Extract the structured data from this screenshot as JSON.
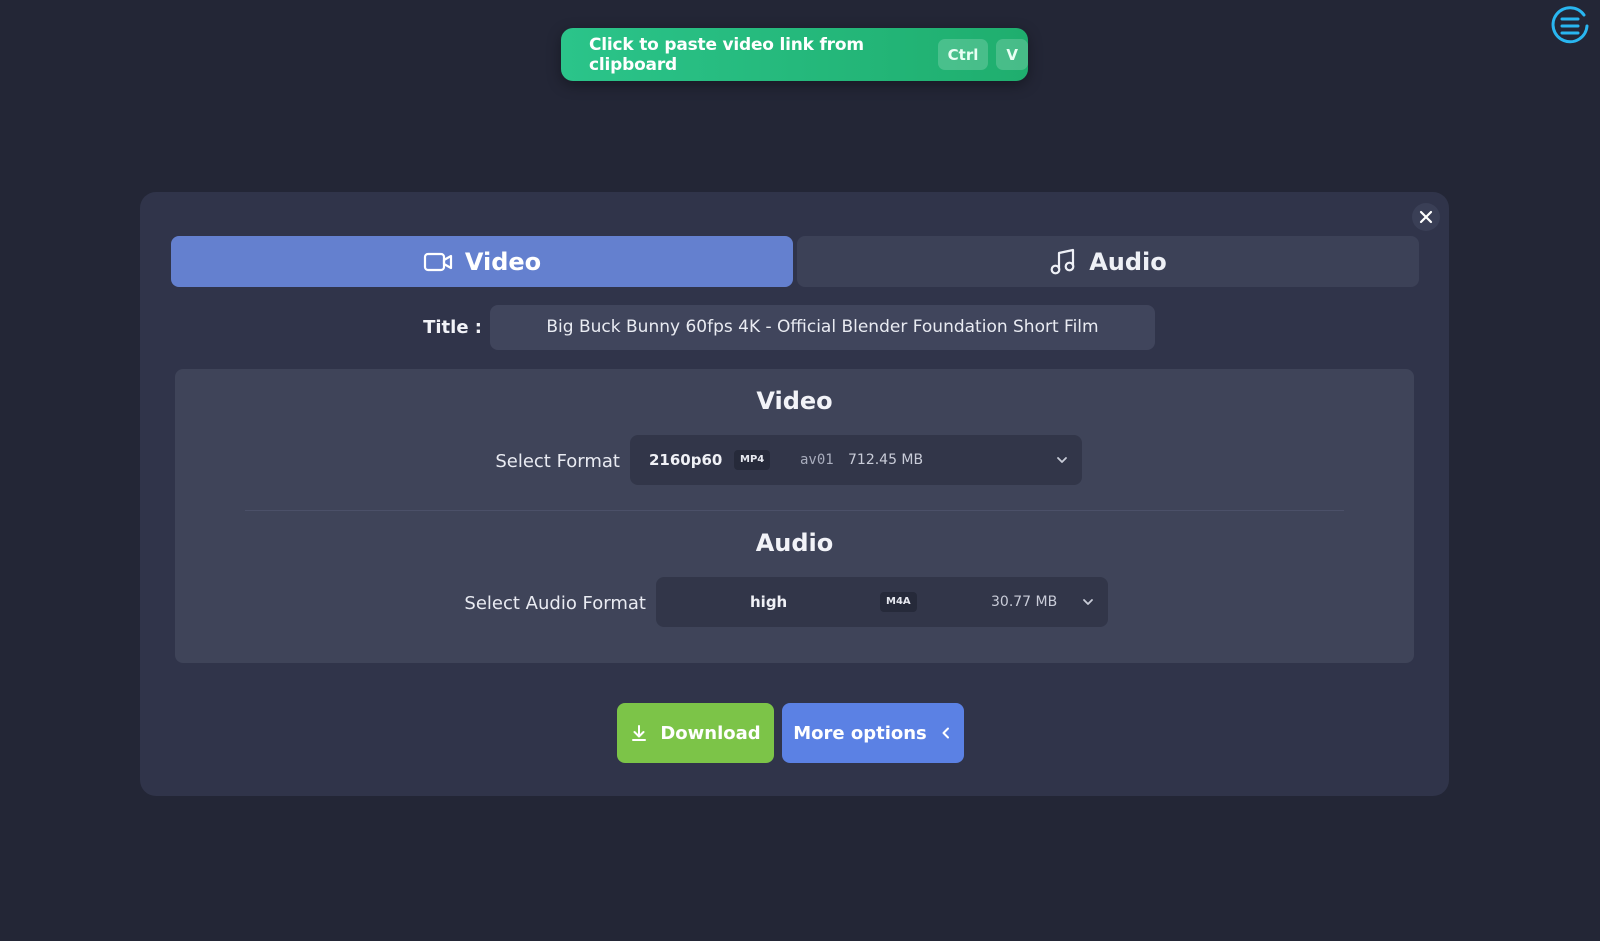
{
  "paste": {
    "label": "Click to paste video link from clipboard",
    "key1": "Ctrl",
    "key2": "V"
  },
  "tabs": {
    "video": "Video",
    "audio": "Audio"
  },
  "title": {
    "label": "Title :",
    "value": "Big Buck Bunny 60fps 4K - Official Blender Foundation Short Film"
  },
  "video_section": {
    "heading": "Video",
    "select_label": "Select Format",
    "selected": {
      "resolution": "2160p60",
      "container": "MP4",
      "codec": "av01",
      "size": "712.45 MB"
    }
  },
  "audio_section": {
    "heading": "Audio",
    "select_label": "Select Audio Format",
    "selected": {
      "quality": "high",
      "container": "M4A",
      "size": "30.77 MB"
    }
  },
  "actions": {
    "download": "Download",
    "more_options": "More options"
  },
  "colors": {
    "background": "#232636",
    "panel": "#30344a",
    "paste_green": "#2bc48a",
    "active_tab": "#6480cf",
    "download_green": "#7cc448",
    "more_blue": "#5b81e4",
    "menu_cyan": "#29b6f0"
  },
  "icons": [
    "menu-icon",
    "close-icon",
    "video-camera-icon",
    "music-note-icon",
    "chevron-down-icon",
    "download-icon",
    "chevron-left-icon"
  ]
}
